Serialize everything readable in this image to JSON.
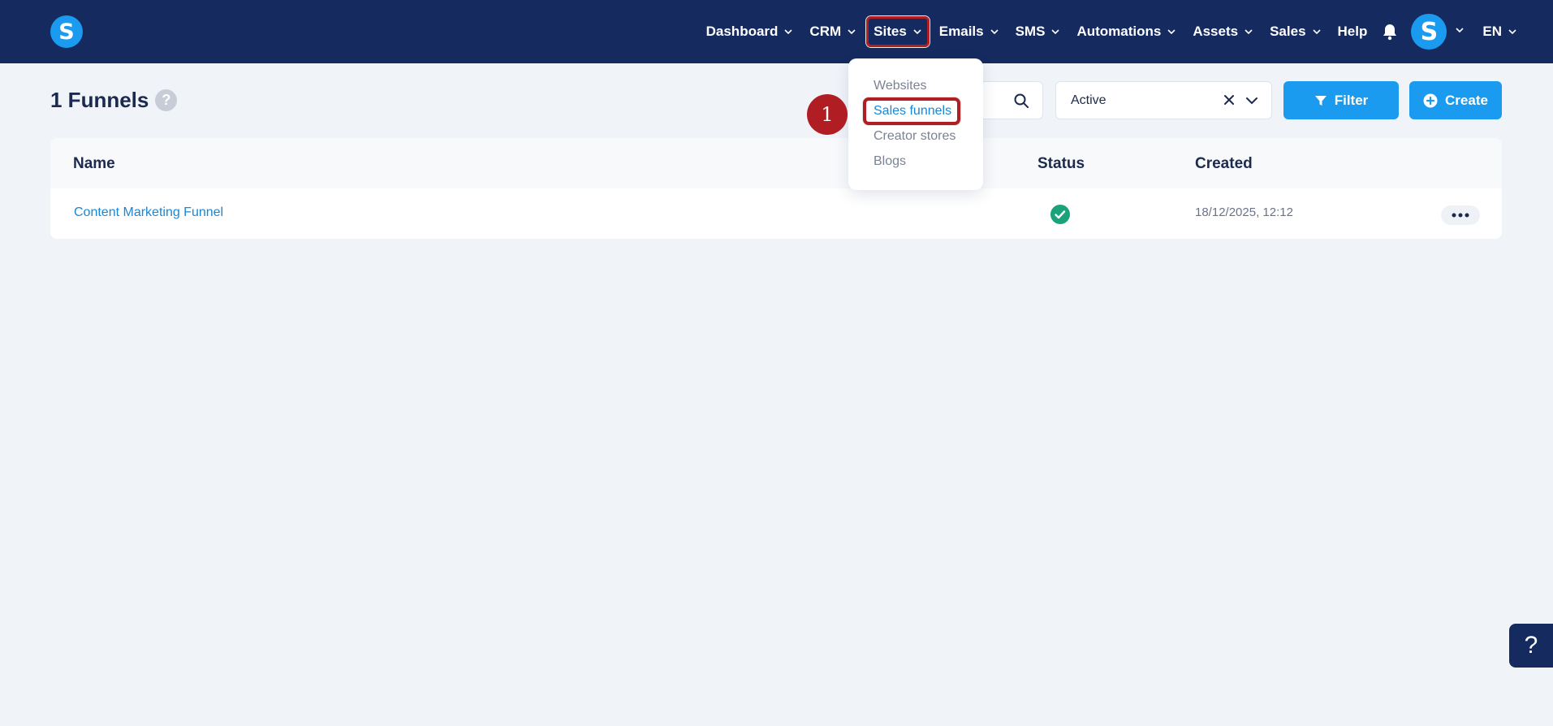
{
  "brand": {
    "logo_letter": "S"
  },
  "nav": {
    "items": [
      {
        "label": "Dashboard",
        "has_menu": true
      },
      {
        "label": "CRM",
        "has_menu": true
      },
      {
        "label": "Sites",
        "has_menu": true,
        "highlighted": true
      },
      {
        "label": "Emails",
        "has_menu": true
      },
      {
        "label": "SMS",
        "has_menu": true
      },
      {
        "label": "Automations",
        "has_menu": true
      },
      {
        "label": "Assets",
        "has_menu": true
      },
      {
        "label": "Sales",
        "has_menu": true
      },
      {
        "label": "Help",
        "has_menu": false
      }
    ],
    "avatar_letter": "S",
    "language": "EN"
  },
  "page": {
    "title": "1 Funnels",
    "help_glyph": "?"
  },
  "toolbar": {
    "status_value": "Active",
    "filter_label": "Filter",
    "create_label": "Create"
  },
  "table": {
    "columns": {
      "name": "Name",
      "status": "Status",
      "created": "Created"
    },
    "rows": [
      {
        "name": "Content Marketing Funnel",
        "status": "active",
        "created": "18/12/2025, 12:12"
      }
    ]
  },
  "sites_menu": {
    "items": [
      {
        "label": "Websites"
      },
      {
        "label": "Sales funnels",
        "active": true
      },
      {
        "label": "Creator stores"
      },
      {
        "label": "Blogs"
      }
    ]
  },
  "annotation": {
    "step": "1"
  },
  "help_widget": {
    "glyph": "?"
  },
  "colors": {
    "nav_bg": "#152a5e",
    "accent": "#1a9bef",
    "highlight": "#b01e23",
    "success": "#1aa37a",
    "page_bg": "#f0f3f8"
  }
}
